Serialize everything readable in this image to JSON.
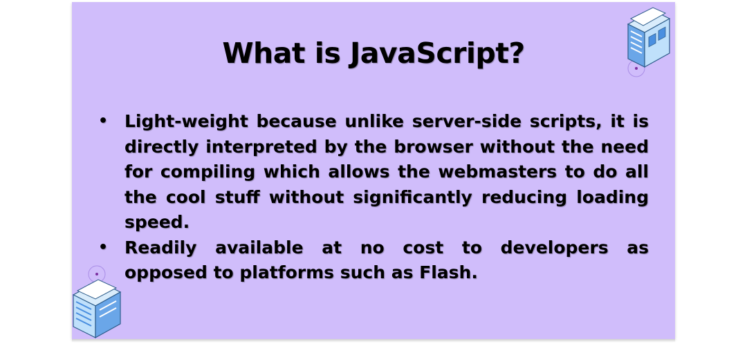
{
  "slide": {
    "title": "What is JavaScript?",
    "bullets": [
      {
        "marker": "•",
        "text": "Light-weight because unlike server-side scripts, it is directly interpreted by the browser without the need for compiling which allows the webmasters to do all the cool stuff without significantly reducing loading speed."
      },
      {
        "marker": "•",
        "text": "Readily available at no cost to developers as opposed to platforms such as Flash."
      }
    ]
  },
  "colors": {
    "slide_background": "#d0bdfb",
    "text": "#000000",
    "server_blue": "#4a8fe0",
    "server_light": "#bfe0fb"
  },
  "icons": [
    "server-icon",
    "server-icon"
  ]
}
